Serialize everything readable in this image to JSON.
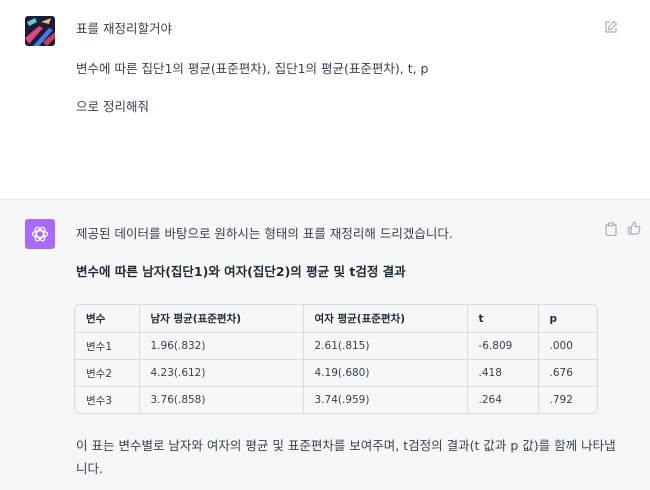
{
  "user_message": {
    "line1": "표를 재정리할거야",
    "line2": "변수에 따른 집단1의 평균(표준편차), 집단1의 평균(표준편차), t, p",
    "line3": "으로 정리해줘"
  },
  "assistant_message": {
    "intro": "제공된 데이터를 바탕으로 원하시는 형태의 표를 재정리해 드리겠습니다.",
    "heading": "변수에 따른 남자(집단1)와 여자(집단2)의 평균 및 t검정 결과",
    "table": {
      "headers": [
        "변수",
        "남자 평균(표준편차)",
        "여자 평균(표준편차)",
        "t",
        "p"
      ],
      "rows": [
        [
          "변수1",
          "1.96(.832)",
          "2.61(.815)",
          "-6.809",
          ".000"
        ],
        [
          "변수2",
          "4.23(.612)",
          "4.19(.680)",
          ".418",
          ".676"
        ],
        [
          "변수3",
          "3.76(.858)",
          "3.74(.959)",
          ".264",
          ".792"
        ]
      ]
    },
    "summary": "이 표는 변수별로 남자와 여자의 평균 및 표준편차를 보여주며, t검정의 결과(t 값과 p 값)를 함께 나타냅니다."
  },
  "icons": {
    "user_avatar": "abstract-art-avatar",
    "assistant_avatar": "openai-logo-icon",
    "edit": "edit-icon",
    "copy": "clipboard-icon",
    "like": "thumbs-up-icon"
  },
  "colors": {
    "assistant_avatar_bg": "#ab68ff",
    "assistant_bg": "#f7f7f8",
    "text": "#374151"
  }
}
